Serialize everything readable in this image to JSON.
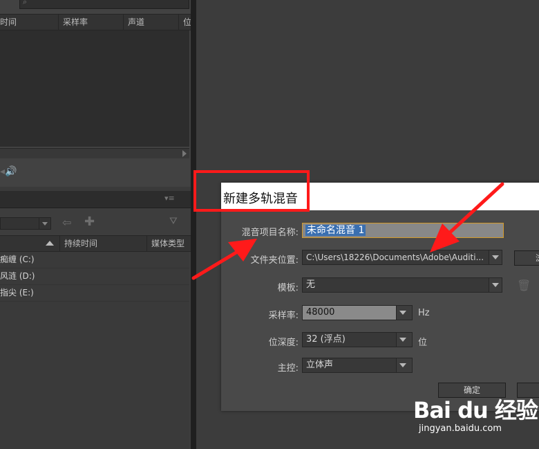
{
  "files_panel": {
    "columns": [
      "时间",
      "采样率",
      "声道",
      "位"
    ]
  },
  "media_panel": {
    "columns": [
      "持续时间",
      "媒体类型"
    ],
    "drives": [
      "痴缠 (C:)",
      "风涟 (D:)",
      "指尖 (E:)"
    ]
  },
  "dialog": {
    "title": "新建多轨混音",
    "mix_name_label": "混音项目名称:",
    "mix_name_value": "未命名混音 1",
    "folder_label": "文件夹位置:",
    "folder_value": "C:\\Users\\18226\\Documents\\Adobe\\Auditi...",
    "browse_label": "浏",
    "template_label": "模板:",
    "template_value": "无",
    "sample_rate_label": "采样率:",
    "sample_rate_value": "48000",
    "sample_rate_unit": "Hz",
    "bit_depth_label": "位深度:",
    "bit_depth_value": "32 (浮点)",
    "bit_depth_unit": "位",
    "master_label": "主控:",
    "master_value": "立体声",
    "ok_label": "确定"
  },
  "watermark": {
    "logo": "Bai du 经验",
    "url": "jingyan.baidu.com"
  },
  "colors": {
    "highlight": "#ff1a1a",
    "selection": "#3a6fb0",
    "focus_border": "#d39a2a"
  }
}
